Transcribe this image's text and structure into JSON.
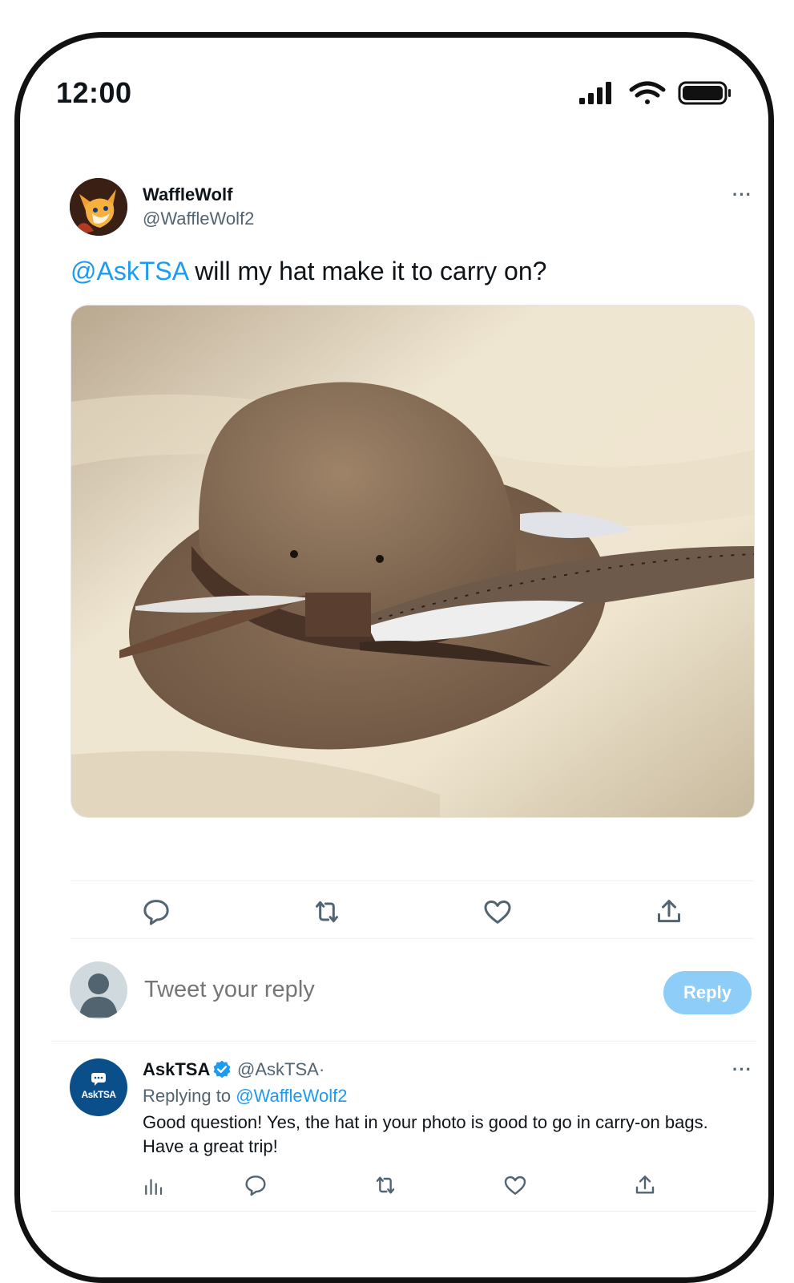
{
  "status_bar": {
    "time": "12:00"
  },
  "tweet": {
    "author_name": "WaffleWolf",
    "author_handle": "@WaffleWolf2",
    "more": "···",
    "mention": "@AskTSA",
    "text": " will my hat make it to carry on?"
  },
  "actions": [
    "reply-icon",
    "retweet-icon",
    "like-icon",
    "share-icon"
  ],
  "compose": {
    "placeholder": "Tweet your reply",
    "button_label": "Reply"
  },
  "reply": {
    "author_name": "AskTSA",
    "author_handle": "@AskTSA",
    "separator": "·",
    "replying_prefix": "Replying to ",
    "replying_handle": "@WaffleWolf2",
    "text_line1": "Good question! Yes, the hat in your photo is good to go in carry-on bags.",
    "text_line2": "Have a great trip!",
    "avatar_label": "AskTSA",
    "more": "···"
  },
  "colors": {
    "accent": "#1d9bf0",
    "reply_button": "#8ecdf7",
    "tsa_avatar": "#0b4f8a"
  }
}
